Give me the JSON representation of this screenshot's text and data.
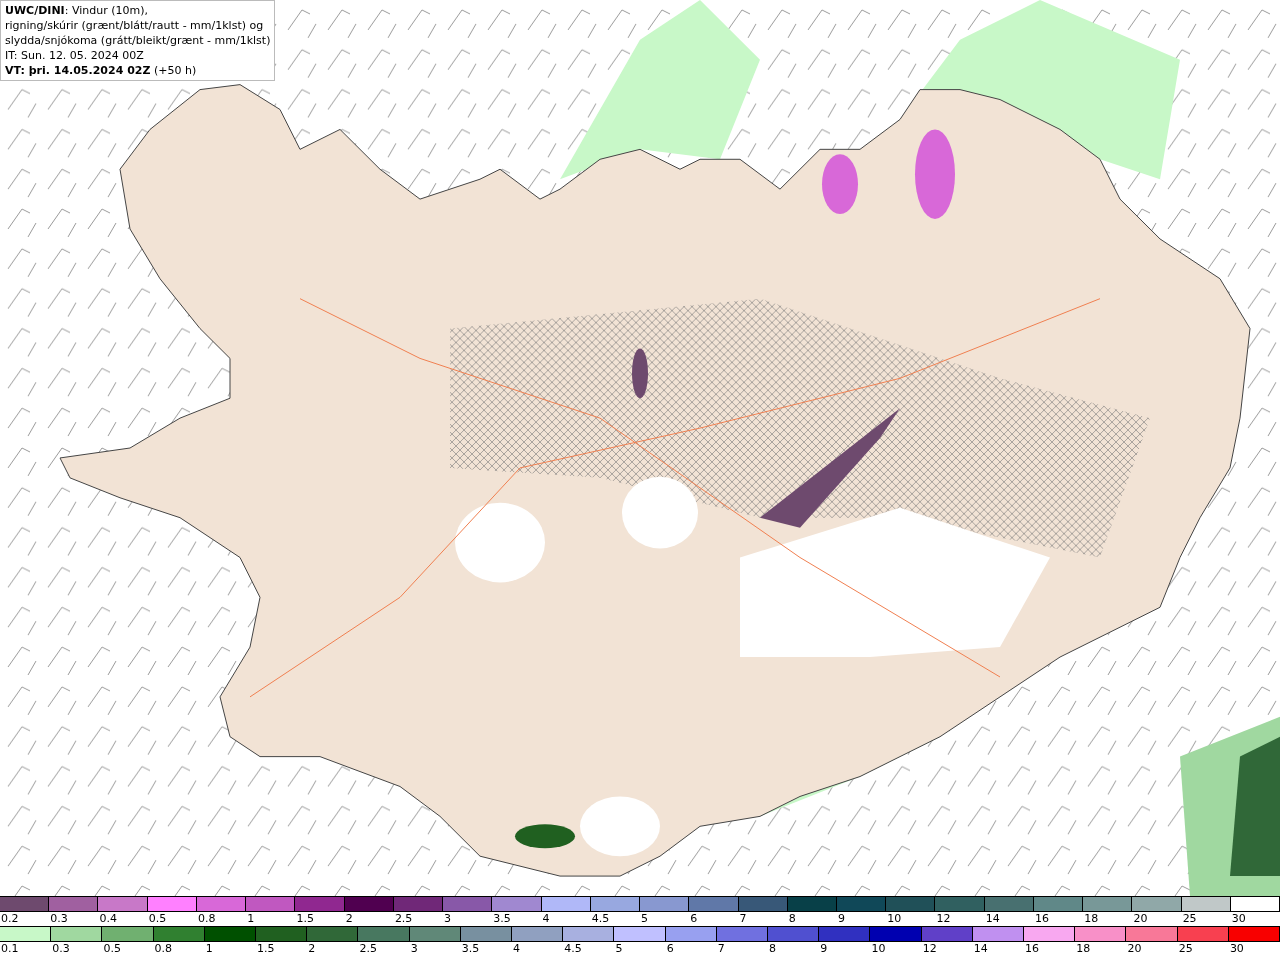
{
  "header": {
    "lines": [
      "**UWC/DINI**: Vindur (10m),",
      "rigning/skúrir (grænt/blátt/rautt - mm/1klst) og",
      "slydda/snjókoma (grátt/bleikt/grænt - mm/1klst)",
      "IT: Sun. 12. 05. 2024 00Z",
      "**VT: þri. 14.05.2024 02Z** (+50 h)"
    ]
  },
  "legends": [
    {
      "bins": [
        {
          "label": "0.2",
          "color": "#6e4a6e"
        },
        {
          "label": "0.3",
          "color": "#a060a0"
        },
        {
          "label": "0.4",
          "color": "#c878c8"
        },
        {
          "label": "0.5",
          "color": "#ff80ff"
        },
        {
          "label": "0.8",
          "color": "#d868d8"
        },
        {
          "label": "1",
          "color": "#c058c0"
        },
        {
          "label": "1.5",
          "color": "#902890"
        },
        {
          "label": "2",
          "color": "#500050"
        },
        {
          "label": "2.5",
          "color": "#702878"
        },
        {
          "label": "3",
          "color": "#8858a8"
        },
        {
          "label": "3.5",
          "color": "#a088d0"
        },
        {
          "label": "4",
          "color": "#b0b8f8"
        },
        {
          "label": "4.5",
          "color": "#98a8e0"
        },
        {
          "label": "5",
          "color": "#8898d0"
        },
        {
          "label": "6",
          "color": "#6078a8"
        },
        {
          "label": "7",
          "color": "#385878"
        },
        {
          "label": "8",
          "color": "#084048"
        },
        {
          "label": "9",
          "color": "#104858"
        },
        {
          "label": "10",
          "color": "#205058"
        },
        {
          "label": "12",
          "color": "#306060"
        },
        {
          "label": "14",
          "color": "#487070"
        },
        {
          "label": "16",
          "color": "#608888"
        },
        {
          "label": "18",
          "color": "#789898"
        },
        {
          "label": "20",
          "color": "#90a8a8"
        },
        {
          "label": "25",
          "color": "#c0c8c8"
        },
        {
          "label": "30",
          "color": "#ffffff"
        }
      ]
    },
    {
      "bins": [
        {
          "label": "0.1",
          "color": "#c8f8c8"
        },
        {
          "label": "0.3",
          "color": "#a0d8a0"
        },
        {
          "label": "0.5",
          "color": "#70b070"
        },
        {
          "label": "0.8",
          "color": "#308030"
        },
        {
          "label": "1",
          "color": "#005000"
        },
        {
          "label": "1.5",
          "color": "#206020"
        },
        {
          "label": "2",
          "color": "#306838"
        },
        {
          "label": "2.5",
          "color": "#487860"
        },
        {
          "label": "3",
          "color": "#608878"
        },
        {
          "label": "3.5",
          "color": "#7890a0"
        },
        {
          "label": "4",
          "color": "#90a0c0"
        },
        {
          "label": "4.5",
          "color": "#a8b0e0"
        },
        {
          "label": "5",
          "color": "#c0c0ff"
        },
        {
          "label": "6",
          "color": "#98a0f0"
        },
        {
          "label": "7",
          "color": "#7070e0"
        },
        {
          "label": "8",
          "color": "#5050d0"
        },
        {
          "label": "9",
          "color": "#3030c0"
        },
        {
          "label": "10",
          "color": "#0000b0"
        },
        {
          "label": "12",
          "color": "#6040c8"
        },
        {
          "label": "14",
          "color": "#c090f0"
        },
        {
          "label": "16",
          "color": "#f8a8f0"
        },
        {
          "label": "18",
          "color": "#f890c8"
        },
        {
          "label": "20",
          "color": "#f87898"
        },
        {
          "label": "25",
          "color": "#f84050"
        },
        {
          "label": "30",
          "color": "#f80000"
        }
      ]
    }
  ]
}
